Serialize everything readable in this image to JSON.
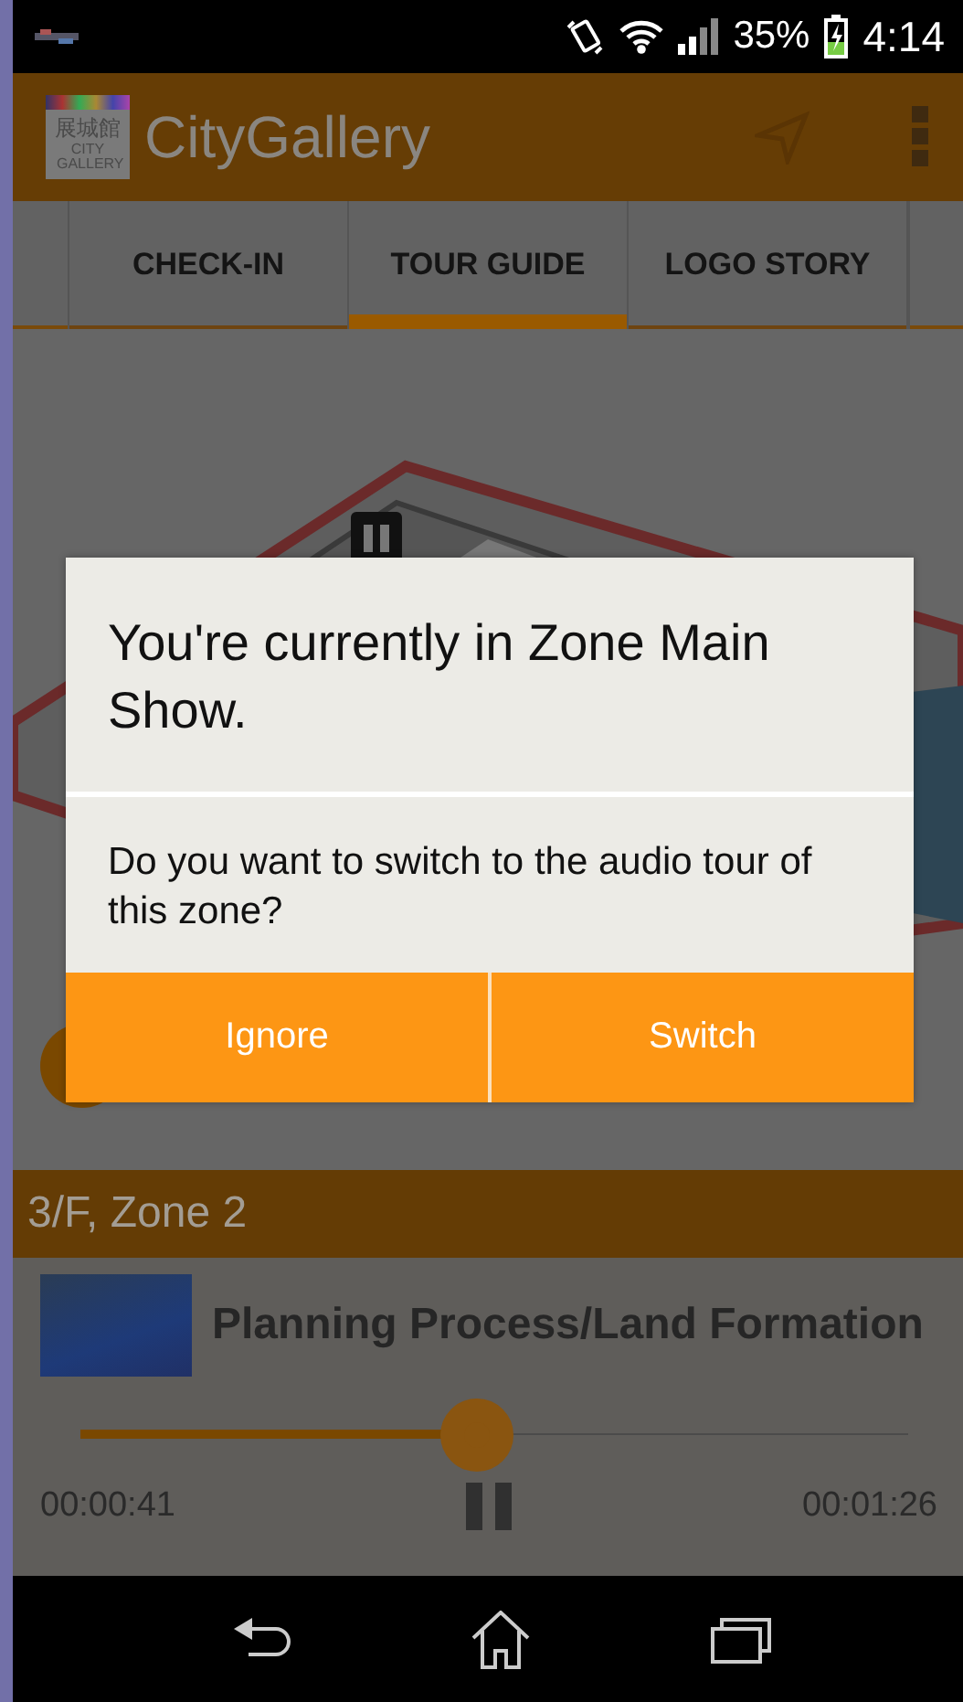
{
  "status_bar": {
    "battery_percent": "35%",
    "time": "4:14"
  },
  "app_bar": {
    "logo": {
      "name_zh": "展城館",
      "name_en": "CITY GALLERY"
    },
    "title": "CityGallery"
  },
  "tabs": [
    {
      "label": "CHECK-IN",
      "selected": false
    },
    {
      "label": "TOUR GUIDE",
      "selected": true
    },
    {
      "label": "LOGO STORY",
      "selected": false
    }
  ],
  "now_playing": {
    "zone": "3/F, Zone 2",
    "title": "Planning Process/Land Formation",
    "level": 0.48,
    "elapsed": "00:00:41",
    "duration": "00:01:26",
    "playing": true
  },
  "dialog": {
    "title": "You're currently in Zone Main Show.",
    "message": "Do you want to switch to the audio tour of this zone?",
    "buttons": [
      "Ignore",
      "Switch"
    ]
  }
}
